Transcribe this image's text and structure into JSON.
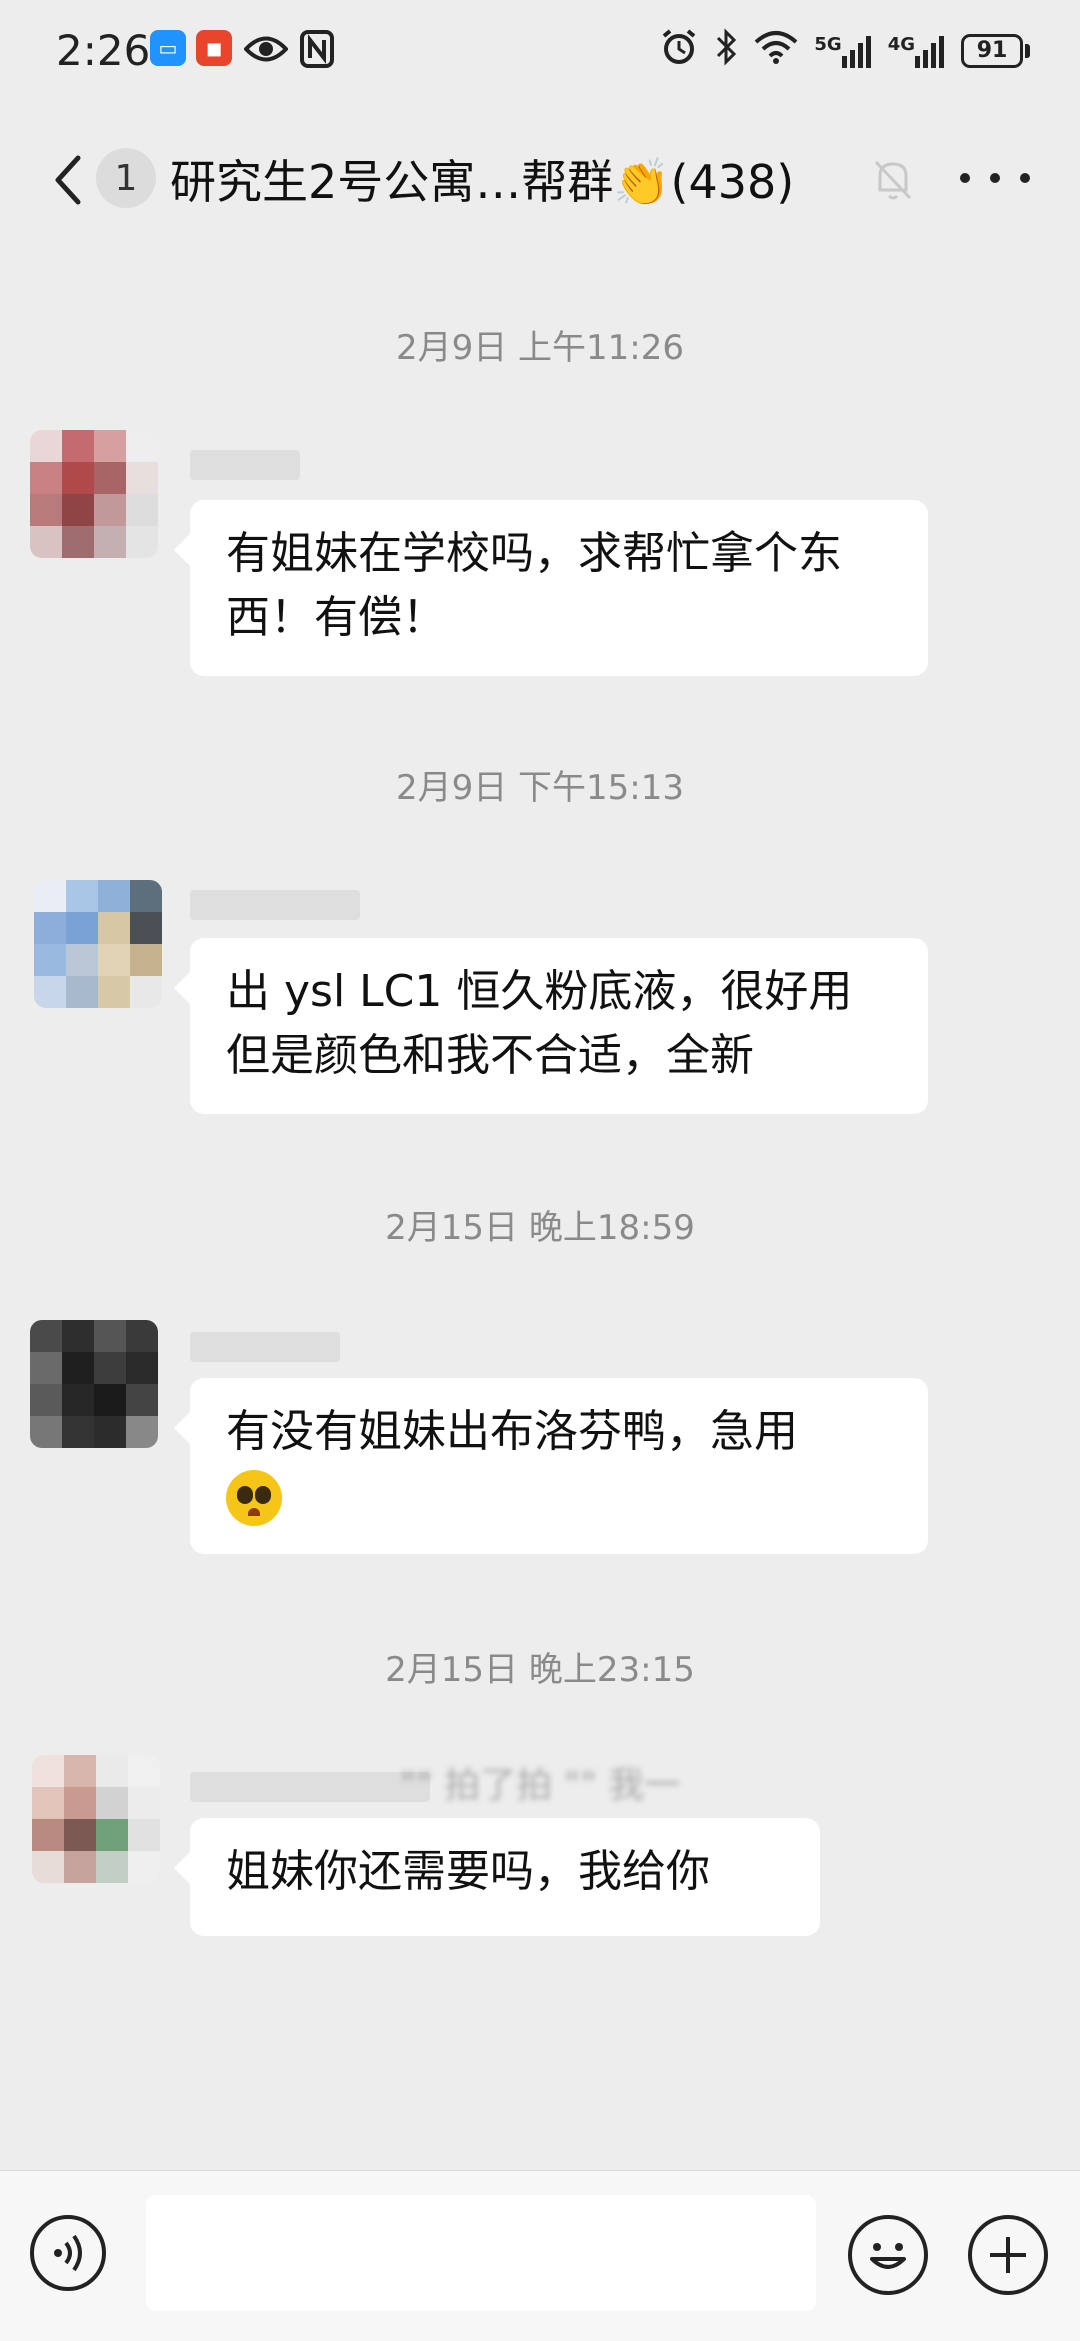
{
  "status_bar": {
    "time": "2:26",
    "network_5g": "5G",
    "network_4g": "4G",
    "battery": "91"
  },
  "header": {
    "unread_count": "1",
    "title": "研究生2号公寓…帮群👏(438)"
  },
  "messages": [
    {
      "timestamp": "2月9日 上午11:26",
      "text": "有姐妹在学校吗，求帮忙拿个东西！有偿！"
    },
    {
      "timestamp": "2月9日 下午15:13",
      "text": "出 ysl LC1 恒久粉底液，很好用但是颜色和我不合适，全新"
    },
    {
      "timestamp": "2月15日 晚上18:59",
      "text": "有没有姐妹出布洛芬鸭，急用"
    },
    {
      "timestamp": "2月15日 晚上23:15",
      "text": "姐妹你还需要吗，我给你"
    }
  ],
  "system_note": "\"\" 拍了拍 \"\" 我一",
  "icons": {
    "back": "chevron-left-icon",
    "mute": "bell-off-icon",
    "more": "more-icon",
    "voice": "voice-icon",
    "emoji": "smiley-icon",
    "plus": "plus-icon"
  }
}
